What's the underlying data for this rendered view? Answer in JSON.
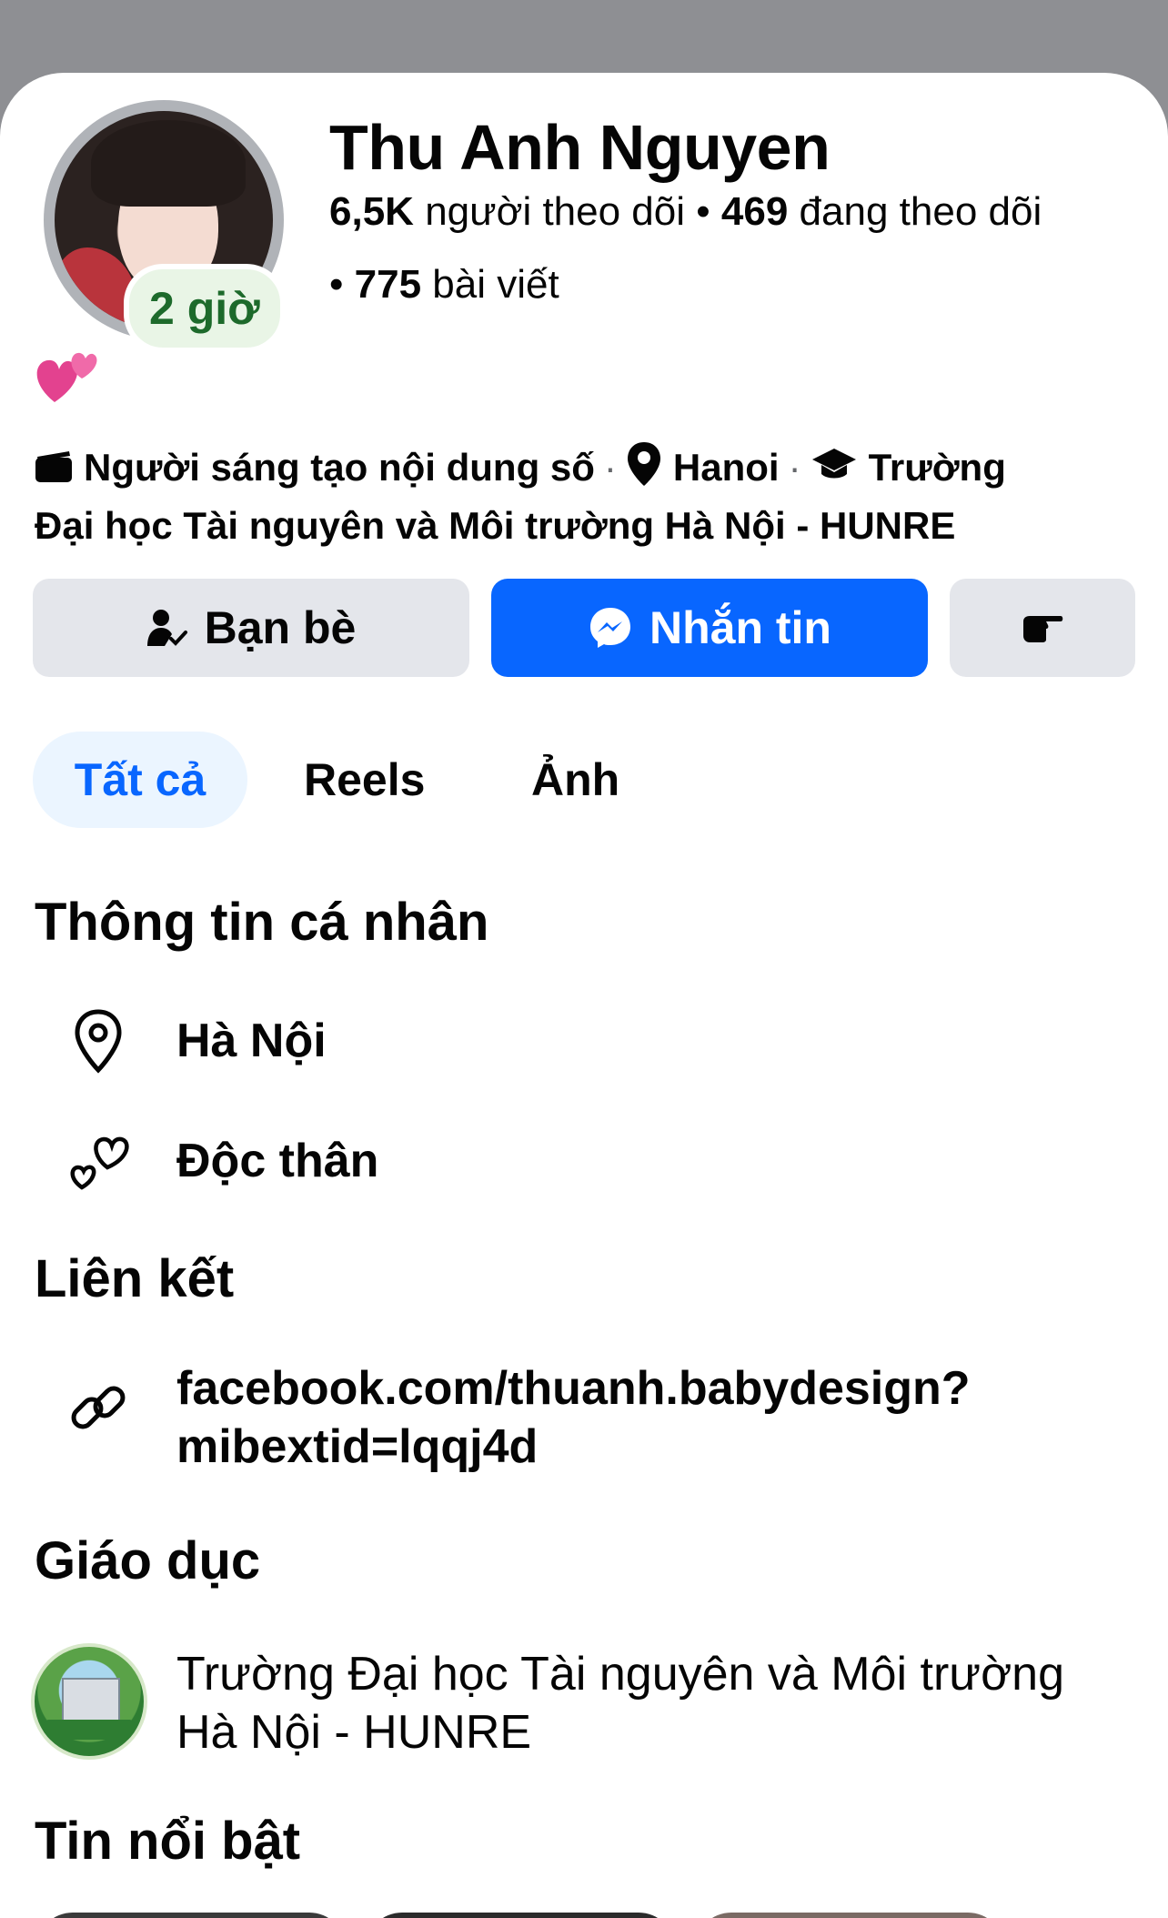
{
  "profile": {
    "name": "Thu Anh Nguyen",
    "story_badge": "2 giờ",
    "stats": {
      "followers_count": "6,5K",
      "followers_label": "người theo dõi",
      "following_count": "469",
      "following_label": "đang theo dõi",
      "posts_count": "775",
      "posts_label": "bài viết",
      "separator": "•"
    },
    "bio_emoji": "💕"
  },
  "details": {
    "creator": "Người sáng tạo nội dung số",
    "location": "Hanoi",
    "school_line1": "Trường",
    "school_line2": "Đại học Tài nguyên và Môi trường Hà Nội - HUNRE",
    "separator": "·"
  },
  "actions": {
    "friends_label": "Bạn bè",
    "message_label": "Nhắn tin",
    "more_icon": "hand-pointing-icon"
  },
  "tabs": [
    {
      "label": "Tất cả",
      "active": true
    },
    {
      "label": "Reels",
      "active": false
    },
    {
      "label": "Ảnh",
      "active": false
    }
  ],
  "personal_info": {
    "title": "Thông tin cá nhân",
    "city": "Hà Nội",
    "relationship": "Độc thân"
  },
  "links": {
    "title": "Liên kết",
    "url_line1": "facebook.com/thuanh.babydesign?",
    "url_line2": "mibextid=lqqj4d"
  },
  "education": {
    "title": "Giáo dục",
    "school_line1": "Trường Đại học Tài nguyên và Môi trường",
    "school_line2": "Hà Nội - HUNRE"
  },
  "featured": {
    "title": "Tin nổi bật"
  },
  "colors": {
    "accent": "#0866ff",
    "button_gray": "#e4e6eb",
    "tab_active_bg": "#ebf5ff",
    "badge_green_bg": "#e9f5e6",
    "badge_green_text": "#1d6a2b"
  }
}
